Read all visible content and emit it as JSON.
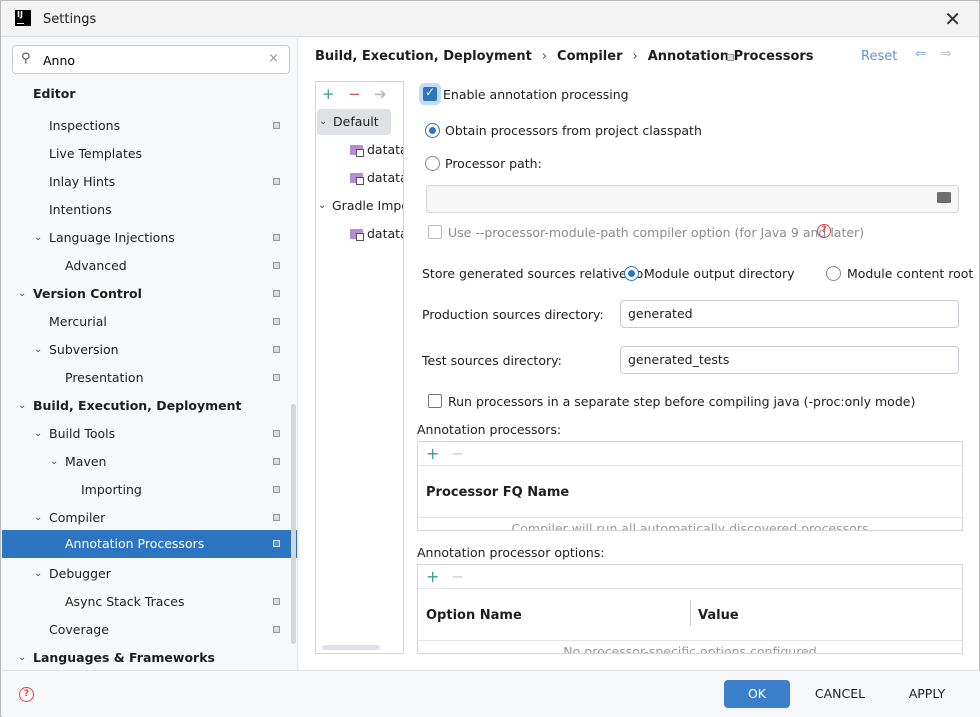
{
  "window": {
    "title": "Settings"
  },
  "search": {
    "value": "Anno"
  },
  "tree": [
    {
      "label": "Editor"
    },
    {
      "label": "Inspections"
    },
    {
      "label": "Live Templates"
    },
    {
      "label": "Inlay Hints"
    },
    {
      "label": "Intentions"
    },
    {
      "label": "Language Injections"
    },
    {
      "label": "Advanced"
    },
    {
      "label": "Version Control"
    },
    {
      "label": "Mercurial"
    },
    {
      "label": "Subversion"
    },
    {
      "label": "Presentation"
    },
    {
      "label": "Build, Execution, Deployment"
    },
    {
      "label": "Build Tools"
    },
    {
      "label": "Maven"
    },
    {
      "label": "Importing"
    },
    {
      "label": "Compiler"
    },
    {
      "label": "Annotation Processors"
    },
    {
      "label": "Debugger"
    },
    {
      "label": "Async Stack Traces"
    },
    {
      "label": "Coverage"
    },
    {
      "label": "Languages & Frameworks"
    }
  ],
  "breadcrumb": {
    "part1": "Build, Execution, Deployment",
    "part2": "Compiler",
    "part3": "Annotation Processors",
    "sep": "›"
  },
  "header": {
    "reset": "Reset"
  },
  "profiles": [
    {
      "label": "Default"
    },
    {
      "label": "datata"
    },
    {
      "label": "datata."
    },
    {
      "label": "Gradle Impor"
    },
    {
      "label": "datata."
    }
  ],
  "settings": {
    "enable": "Enable annotation processing",
    "obtain": "Obtain processors from project classpath",
    "processor_path": "Processor path:",
    "module_path": "Use --processor-module-path compiler option (for Java 9 and later)",
    "store_label": "Store generated sources relative to:",
    "store_output": "Module output directory",
    "store_content": "Module content root",
    "prod_label": "Production sources directory:",
    "prod_value": "generated",
    "test_label": "Test sources directory:",
    "test_value": "generated_tests",
    "run_separate": "Run processors in a separate step before compiling java (-proc:only mode)"
  },
  "processors": {
    "title": "Annotation processors:",
    "column": "Processor FQ Name",
    "empty": "Compiler will run all automatically discovered processors"
  },
  "options": {
    "title": "Annotation processor options:",
    "col_name": "Option Name",
    "col_value": "Value",
    "empty": "No processor-specific options configured"
  },
  "buttons": {
    "ok": "OK",
    "cancel": "CANCEL",
    "apply": "APPLY"
  },
  "colors": {
    "accent": "#2e75c1",
    "ok_button": "#3b7fcb",
    "reset_link": "#5d94c8",
    "add_icon": "#3a9b9b",
    "help_icon": "#dd4444"
  }
}
